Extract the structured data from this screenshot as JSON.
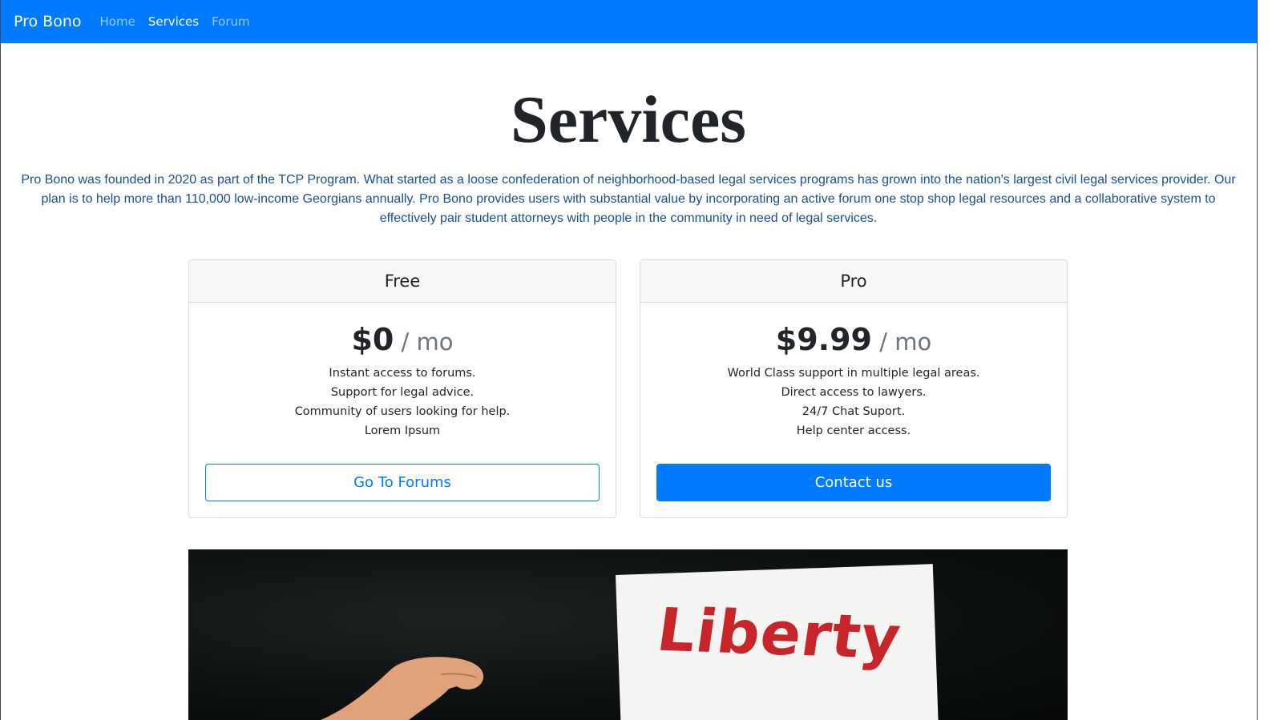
{
  "navbar": {
    "brand": "Pro Bono",
    "links": [
      {
        "label": "Home",
        "active": false
      },
      {
        "label": "Services",
        "active": true
      },
      {
        "label": "Forum",
        "active": false
      }
    ]
  },
  "page": {
    "title": "Services",
    "intro": "Pro Bono was founded in 2020 as part of the TCP Program. What started as a loose confederation of neighborhood-based legal services programs has grown into the nation's largest civil legal services provider. Our plan is to help more than 110,000 low-income Georgians annually. Pro Bono provides users with substantial value by incorporating an active forum one stop shop legal resources and a collaborative system to effectively pair student attorneys with people in the community in need of legal services."
  },
  "plans": [
    {
      "name": "Free",
      "price": "$0",
      "unit": " / mo",
      "features": [
        "Instant access to forums.",
        "Support for legal advice.",
        "Community of users looking for help.",
        "Lorem Ipsum"
      ],
      "button": "Go To Forums"
    },
    {
      "name": "Pro",
      "price": "$9.99",
      "unit": " / mo",
      "features": [
        "World Class support in multiple legal areas.",
        "Direct access to lawyers.",
        "24/7 Chat Suport.",
        "Help center access."
      ],
      "button": "Contact us"
    }
  ],
  "photo": {
    "sign_text": "Liberty"
  },
  "colors": {
    "primary": "#007bff",
    "intro_text": "#1b4f8a",
    "sign_ink": "#c8252a"
  }
}
